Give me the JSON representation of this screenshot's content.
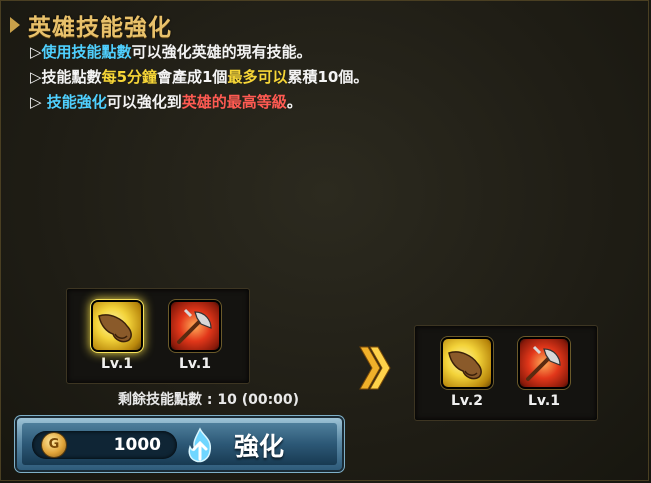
{
  "header": {
    "title": "英雄技能強化"
  },
  "description": {
    "line1": {
      "bullet": "▷",
      "highlight": "使用技能點數",
      "rest": "可以強化英雄的現有技能。"
    },
    "line2": {
      "bullet": "▷",
      "text1": "技能點數",
      "highlight1": "每5分鐘",
      "text2": "會產成1個",
      "highlight2": "最多可以",
      "text3": "累積10個。"
    },
    "line3": {
      "bullet": "▷ ",
      "highlight1": "技能強化",
      "text1": "可以強化到",
      "highlight2": "英雄的最高等級",
      "text2": "。"
    }
  },
  "current": {
    "skills": [
      {
        "icon": "fist-icon",
        "level": "Lv.1"
      },
      {
        "icon": "axe-icon",
        "level": "Lv.1"
      }
    ]
  },
  "result": {
    "skills": [
      {
        "icon": "fist-icon",
        "level": "Lv.2"
      },
      {
        "icon": "axe-icon",
        "level": "Lv.1"
      }
    ]
  },
  "points": {
    "text": "剩餘技能點數 : 10 (00:00)"
  },
  "upgrade": {
    "coin_symbol": "G",
    "cost": "1000",
    "label": "強化"
  },
  "colors": {
    "highlight_blue": "#4fd0ff",
    "highlight_yellow": "#f7d637",
    "highlight_red": "#ff5a52",
    "title_gold": "#e8c16b"
  }
}
